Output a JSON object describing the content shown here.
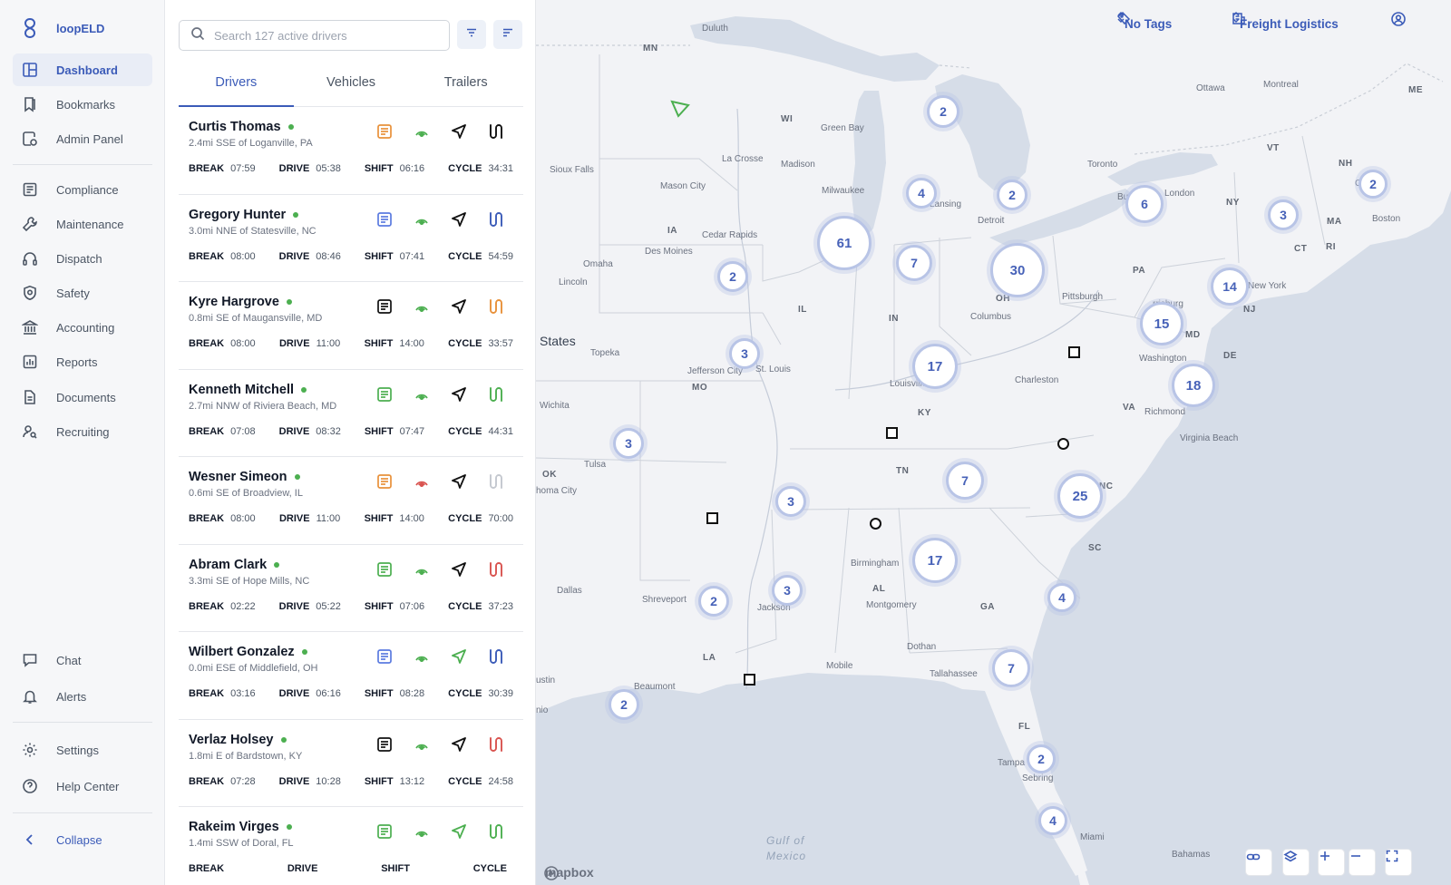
{
  "app": {
    "name": "loopELD"
  },
  "nav": {
    "primary": [
      {
        "label": "Dashboard",
        "icon": "dashboard-icon",
        "active": true
      },
      {
        "label": "Bookmarks",
        "icon": "bookmark-icon"
      },
      {
        "label": "Admin Panel",
        "icon": "admin-icon"
      }
    ],
    "secondary": [
      {
        "label": "Compliance",
        "icon": "compliance-icon"
      },
      {
        "label": "Maintenance",
        "icon": "wrench-icon"
      },
      {
        "label": "Dispatch",
        "icon": "headset-icon"
      },
      {
        "label": "Safety",
        "icon": "shield-icon"
      },
      {
        "label": "Accounting",
        "icon": "bank-icon"
      },
      {
        "label": "Reports",
        "icon": "chart-icon"
      },
      {
        "label": "Documents",
        "icon": "document-icon"
      },
      {
        "label": "Recruiting",
        "icon": "user-search-icon"
      }
    ],
    "bottom": [
      {
        "label": "Chat",
        "icon": "chat-icon"
      },
      {
        "label": "Alerts",
        "icon": "bell-icon"
      }
    ],
    "footer": [
      {
        "label": "Settings",
        "icon": "gear-icon"
      },
      {
        "label": "Help Center",
        "icon": "help-icon"
      }
    ],
    "collapse_label": "Collapse"
  },
  "search": {
    "placeholder": "Search 127 active drivers",
    "value": ""
  },
  "tabs": [
    {
      "label": "Drivers",
      "active": true
    },
    {
      "label": "Vehicles"
    },
    {
      "label": "Trailers"
    }
  ],
  "stat_labels": {
    "break": "BREAK",
    "drive": "DRIVE",
    "shift": "SHIFT",
    "cycle": "CYCLE"
  },
  "drivers": [
    {
      "name": "Curtis Thomas",
      "location": "2.4mi SSE of Loganville, PA",
      "break": "07:59",
      "drive": "05:38",
      "shift": "06:16",
      "cycle": "34:31",
      "log_color": "#e8913a",
      "signal_color": "#4caf50",
      "nav_color": "#111111",
      "route_color": "#111111"
    },
    {
      "name": "Gregory Hunter",
      "location": "3.0mi NNE of Statesville, NC",
      "break": "08:00",
      "drive": "08:46",
      "shift": "07:41",
      "cycle": "54:59",
      "log_color": "#5b7be0",
      "signal_color": "#4caf50",
      "nav_color": "#111111",
      "route_color": "#3b5bb8"
    },
    {
      "name": "Kyre Hargrove",
      "location": "0.8mi SE of Maugansville, MD",
      "break": "08:00",
      "drive": "11:00",
      "shift": "14:00",
      "cycle": "33:57",
      "log_color": "#111111",
      "signal_color": "#4caf50",
      "nav_color": "#111111",
      "route_color": "#e8913a"
    },
    {
      "name": "Kenneth Mitchell",
      "location": "2.7mi NNW of Riviera Beach, MD",
      "break": "07:08",
      "drive": "08:32",
      "shift": "07:47",
      "cycle": "44:31",
      "log_color": "#4caf50",
      "signal_color": "#4caf50",
      "nav_color": "#111111",
      "route_color": "#4caf50"
    },
    {
      "name": "Wesner Simeon",
      "location": "0.6mi SE of Broadview, IL",
      "break": "08:00",
      "drive": "11:00",
      "shift": "14:00",
      "cycle": "70:00",
      "log_color": "#e8913a",
      "signal_color": "#d9534f",
      "nav_color": "#111111",
      "route_color": "#c4c8cf"
    },
    {
      "name": "Abram Clark",
      "location": "3.3mi SE of Hope Mills, NC",
      "break": "02:22",
      "drive": "05:22",
      "shift": "07:06",
      "cycle": "37:23",
      "log_color": "#4caf50",
      "signal_color": "#4caf50",
      "nav_color": "#111111",
      "route_color": "#d9534f"
    },
    {
      "name": "Wilbert Gonzalez",
      "location": "0.0mi ESE of Middlefield, OH",
      "break": "03:16",
      "drive": "06:16",
      "shift": "08:28",
      "cycle": "30:39",
      "log_color": "#5b7be0",
      "signal_color": "#4caf50",
      "nav_color": "#4caf50",
      "route_color": "#3b5bb8"
    },
    {
      "name": "Verlaz Holsey",
      "location": "1.8mi E of Bardstown, KY",
      "break": "07:28",
      "drive": "10:28",
      "shift": "13:12",
      "cycle": "24:58",
      "log_color": "#111111",
      "signal_color": "#4caf50",
      "nav_color": "#111111",
      "route_color": "#d9534f"
    },
    {
      "name": "Rakeim Virges",
      "location": "1.4mi SSW of Doral, FL",
      "break": "",
      "drive": "",
      "shift": "",
      "cycle": "",
      "log_color": "#4caf50",
      "signal_color": "#4caf50",
      "nav_color": "#4caf50",
      "route_color": "#4caf50"
    }
  ],
  "map": {
    "tag_filter": "No Tags",
    "organization": "Freight Logistics",
    "attribution": "mapbox",
    "clusters": [
      {
        "count": "2"
      },
      {
        "count": "4"
      },
      {
        "count": "2"
      },
      {
        "count": "6"
      },
      {
        "count": "3"
      },
      {
        "count": "2"
      },
      {
        "count": "61"
      },
      {
        "count": "7"
      },
      {
        "count": "30"
      },
      {
        "count": "2"
      },
      {
        "count": "14"
      },
      {
        "count": "15"
      },
      {
        "count": "3"
      },
      {
        "count": "17"
      },
      {
        "count": "18"
      },
      {
        "count": "3"
      },
      {
        "count": "7"
      },
      {
        "count": "25"
      },
      {
        "count": "3"
      },
      {
        "count": "17"
      },
      {
        "count": "2"
      },
      {
        "count": "3"
      },
      {
        "count": "4"
      },
      {
        "count": "7"
      },
      {
        "count": "2"
      },
      {
        "count": "2"
      },
      {
        "count": "4"
      }
    ],
    "labels": [
      "Duluth",
      "MN",
      "WI",
      "Green Bay",
      "Ottawa",
      "Montreal",
      "ME",
      "VT",
      "NH",
      "Concor",
      "Boston",
      "MA",
      "CT",
      "RI",
      "NY",
      "Toronto",
      "Buffa",
      "London",
      "Lansing",
      "Detroit",
      "La Crosse",
      "Mason City",
      "Sioux Falls",
      "Madison",
      "Milwaukee",
      "IA",
      "Cedar Rapids",
      "Des Moines",
      "Omaha",
      "Lincoln",
      "States",
      "IL",
      "IN",
      "OH",
      "Columbus",
      "Pittsburgh",
      "PA",
      "New York",
      "NJ",
      "rrisburg",
      "MD",
      "Washington",
      "DE",
      "Topeka",
      "Jefferson City",
      "St. Louis",
      "MO",
      "Louisville",
      "Charleston",
      "KY",
      "Wichita",
      "VA",
      "Richmond",
      "Virginia Beach",
      "OK",
      "Tulsa",
      "homa City",
      "TN",
      "NC",
      "Birmingham",
      "SC",
      "AL",
      "Montgomery",
      "GA",
      "Dallas",
      "Shreveport",
      "Jackson",
      "LA",
      "Dothan",
      "Mobile",
      "Tallahassee",
      "Beaumont",
      "ustin",
      "nio",
      "FL",
      "Tampa",
      "Sebring",
      "Gulf of",
      "Mexico",
      "Miami",
      "Bahamas"
    ]
  }
}
